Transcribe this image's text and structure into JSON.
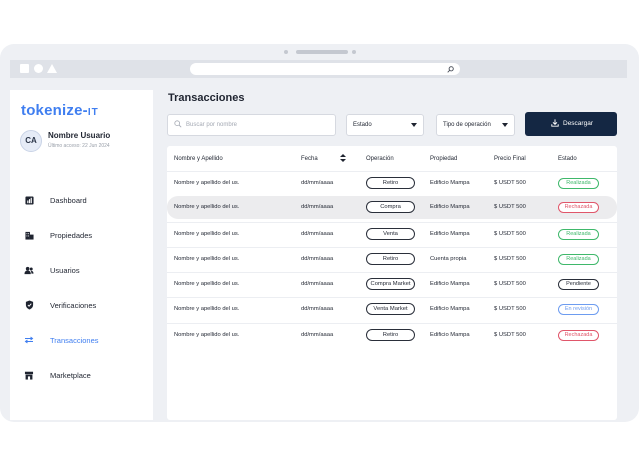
{
  "sidebar": {
    "logo_main": "tokenize-",
    "logo_suffix": "IT",
    "user": {
      "initials": "CA",
      "name": "Nombre Usuario",
      "last_access": "Último acceso: 22 Jun 2024"
    },
    "items": [
      {
        "label": "Dashboard",
        "icon": "chart-icon"
      },
      {
        "label": "Propiedades",
        "icon": "building-icon"
      },
      {
        "label": "Usuarios",
        "icon": "users-icon"
      },
      {
        "label": "Verificaciones",
        "icon": "shield-icon"
      },
      {
        "label": "Transacciones",
        "icon": "transfer-icon",
        "active": true
      },
      {
        "label": "Marketplace",
        "icon": "store-icon"
      }
    ]
  },
  "main": {
    "title": "Transacciones",
    "search_placeholder": "Buscar por nombre",
    "filter_estado": "Estado",
    "filter_tipo": "Tipo de operación",
    "download_label": "Descargar"
  },
  "table": {
    "headers": [
      "Nombre y Apellido",
      "Fecha",
      "Operación",
      "Propiedad",
      "Precio Final",
      "Estado"
    ],
    "rows": [
      {
        "name": "Nombre y apellido del us.",
        "date": "dd/mm/aaaa",
        "operation": "Retiro",
        "property": "Edificio Mampa",
        "price": "$ USDT 500",
        "status": "Realizada",
        "status_type": "success"
      },
      {
        "name": "Nombre y apellido del us.",
        "date": "dd/mm/aaaa",
        "operation": "Compra",
        "property": "Edificio Mampa",
        "price": "$ USDT 500",
        "status": "Rechazada",
        "status_type": "danger"
      },
      {
        "name": "Nombre y apellido del us.",
        "date": "dd/mm/aaaa",
        "operation": "Venta",
        "property": "Edificio Mampa",
        "price": "$ USDT 500",
        "status": "Realizada",
        "status_type": "success"
      },
      {
        "name": "Nombre y apellido del us.",
        "date": "dd/mm/aaaa",
        "operation": "Retiro",
        "property": "Cuenta propia",
        "price": "$ USDT 500",
        "status": "Realizada",
        "status_type": "success"
      },
      {
        "name": "Nombre y apellido del us.",
        "date": "dd/mm/aaaa",
        "operation": "Compra Market",
        "property": "Edificio Mampa",
        "price": "$ USDT 500",
        "status": "Pendiente",
        "status_type": "neutral"
      },
      {
        "name": "Nombre y apellido del us.",
        "date": "dd/mm/aaaa",
        "operation": "Venta Market",
        "property": "Edificio Mampa",
        "price": "$ USDT 500",
        "status": "En revisión",
        "status_type": "info"
      },
      {
        "name": "Nombre y apellido del us.",
        "date": "dd/mm/aaaa",
        "operation": "Retiro",
        "property": "Edificio Mampa",
        "price": "$ USDT 500",
        "status": "Rechazada",
        "status_type": "danger"
      }
    ]
  },
  "colors": {
    "accent": "#3f7ef0",
    "primary_dark": "#142743",
    "success": "#3fb86b",
    "danger": "#e0566a",
    "info": "#6d9cf0",
    "neutral": "#2a2f3a"
  }
}
